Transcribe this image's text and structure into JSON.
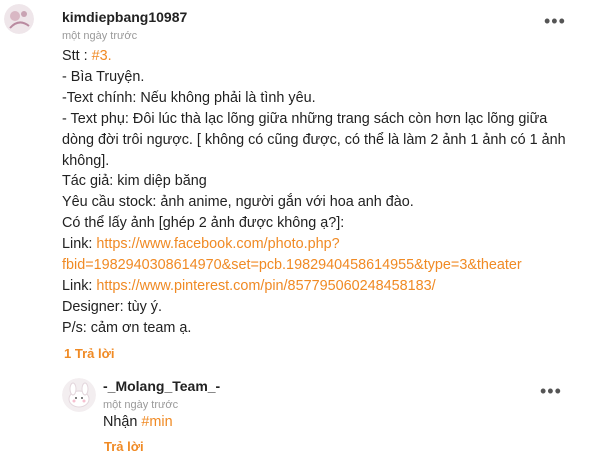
{
  "comment": {
    "username": "kimdiepbang10987",
    "time": "một ngày trước",
    "stt_label": "Stt : ",
    "stt_tag": "#3.",
    "lines": [
      "- Bìa Truyện.",
      "-Text chính: Nếu không phải là tình yêu.",
      "- Text phụ: Đôi lúc thà lạc lõng giữa những trang sách còn hơn lạc lõng giữa",
      "dòng đời trôi ngược. [ không có cũng được, có thể là làm 2 ảnh 1 ảnh có 1 ảnh",
      "không].",
      "Tác giả: kim diệp băng",
      "Yêu cầu stock: ảnh anime, người gắn với hoa anh đào.",
      "Có thể lấy ảnh [ghép 2 ảnh được không ạ?]:"
    ],
    "link1_label": "Link: ",
    "link1_part1": "https://www.facebook.com/photo.php?",
    "link1_part2": "fbid=1982940308614970&set=pcb.1982940458614955&type=3&theater",
    "link2_label": "Link: ",
    "link2": "https://www.pinterest.com/pin/857795060248458183/",
    "designer": "Designer: tùy ý.",
    "ps": "P/s: cảm ơn team ạ.",
    "reply_count": "1 Trả lời",
    "more_icon": "•••"
  },
  "reply": {
    "username": "-_Molang_Team_-",
    "time": "một ngày trước",
    "text_prefix": "Nhận ",
    "tag": "#min",
    "reply_link": "Trả lời",
    "more_icon": "•••"
  },
  "colors": {
    "accent": "#f08a24",
    "muted": "#9a9a9a",
    "text": "#222222"
  }
}
